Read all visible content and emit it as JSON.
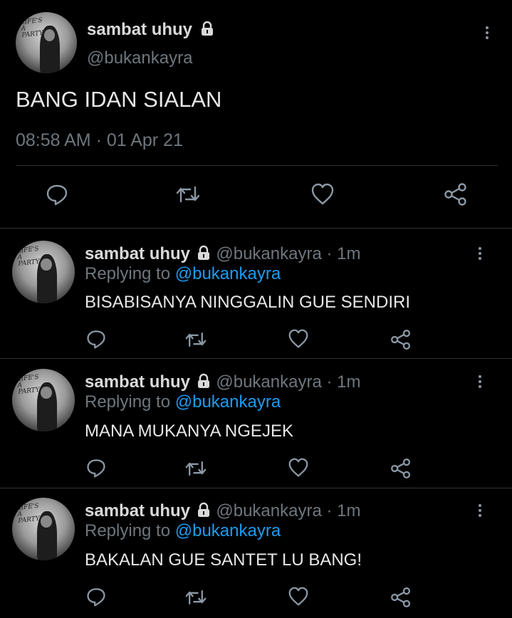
{
  "main_tweet": {
    "display_name": "sambat uhuy",
    "handle": "@bukankayra",
    "text": "BANG IDAN SIALAN",
    "timestamp": "08:58 AM · 01 Apr 21",
    "actions": [
      "reply-icon",
      "retweet-icon",
      "like-icon",
      "share-icon"
    ]
  },
  "replies": [
    {
      "display_name": "sambat uhuy",
      "handle": "@bukankayra",
      "time": "· 1m",
      "replying_prefix": "Replying to",
      "replying_handle": "@bukankayra",
      "text": "BISABISANYA NINGGALIN GUE SENDIRI"
    },
    {
      "display_name": "sambat uhuy",
      "handle": "@bukankayra",
      "time": "· 1m",
      "replying_prefix": "Replying to",
      "replying_handle": "@bukankayra",
      "text": "MANA MUKANYA NGEJEK"
    },
    {
      "display_name": "sambat uhuy",
      "handle": "@bukankayra",
      "time": "· 1m",
      "replying_prefix": "Replying to",
      "replying_handle": "@bukankayra",
      "text": "BAKALAN GUE SANTET LU BANG!"
    }
  ],
  "colors": {
    "background": "#000000",
    "text": "#d9d9d9",
    "muted": "#6e767d",
    "link": "#1d9bf0",
    "divider": "#2f3336"
  }
}
